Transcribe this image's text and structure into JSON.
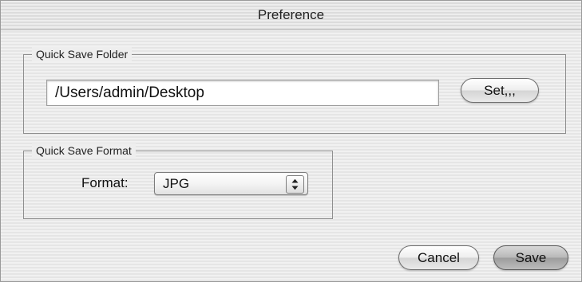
{
  "window": {
    "title": "Preference"
  },
  "quick_save_folder": {
    "legend": "Quick Save Folder",
    "path_value": "/Users/admin/Desktop",
    "set_button_label": "Set,,,"
  },
  "quick_save_format": {
    "legend": "Quick Save Format",
    "format_label": "Format:",
    "selected_format": "JPG",
    "selector_icon": "up-down-arrows-icon"
  },
  "actions": {
    "cancel_label": "Cancel",
    "save_label": "Save"
  },
  "colors": {
    "default_button": "#b0b0b0",
    "panel_background": "#eeeeee",
    "group_border": "#8f8f8f"
  }
}
